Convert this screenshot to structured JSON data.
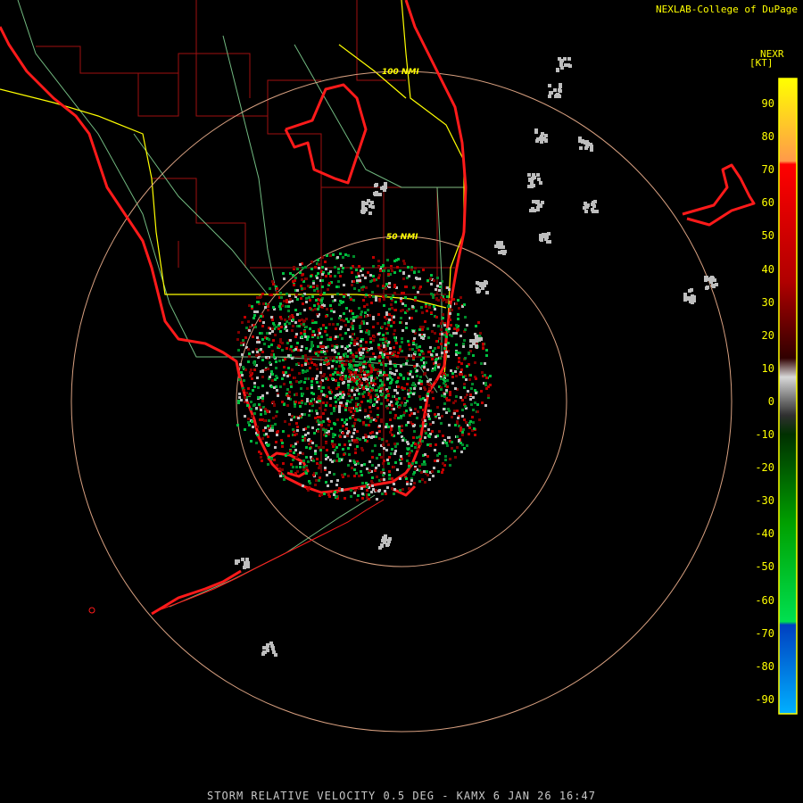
{
  "credit": "NEXLAB-College of DuPage",
  "legend": {
    "title": "NEXR",
    "unit": "[KT]",
    "ticks": [
      "90",
      "80",
      "70",
      "60",
      "50",
      "40",
      "30",
      "20",
      "10",
      "0",
      "-10",
      "-20",
      "-30",
      "-40",
      "-50",
      "-60",
      "-70",
      "-80",
      "-90"
    ]
  },
  "rings": [
    {
      "label": "100 NMI"
    },
    {
      "label": "50 NMI"
    }
  ],
  "footer": "STORM RELATIVE VELOCITY 0.5 DEG - KAMX 6 JAN 26 16:47",
  "colors": {
    "coast": "#ff1a1a",
    "counties": "#a01010",
    "highways": "#ffff00",
    "roads": "#7fcf8f",
    "rings": "#d8a080",
    "inbound": "#00c040",
    "outbound": "#c00000",
    "near_zero": "#bebebe"
  }
}
